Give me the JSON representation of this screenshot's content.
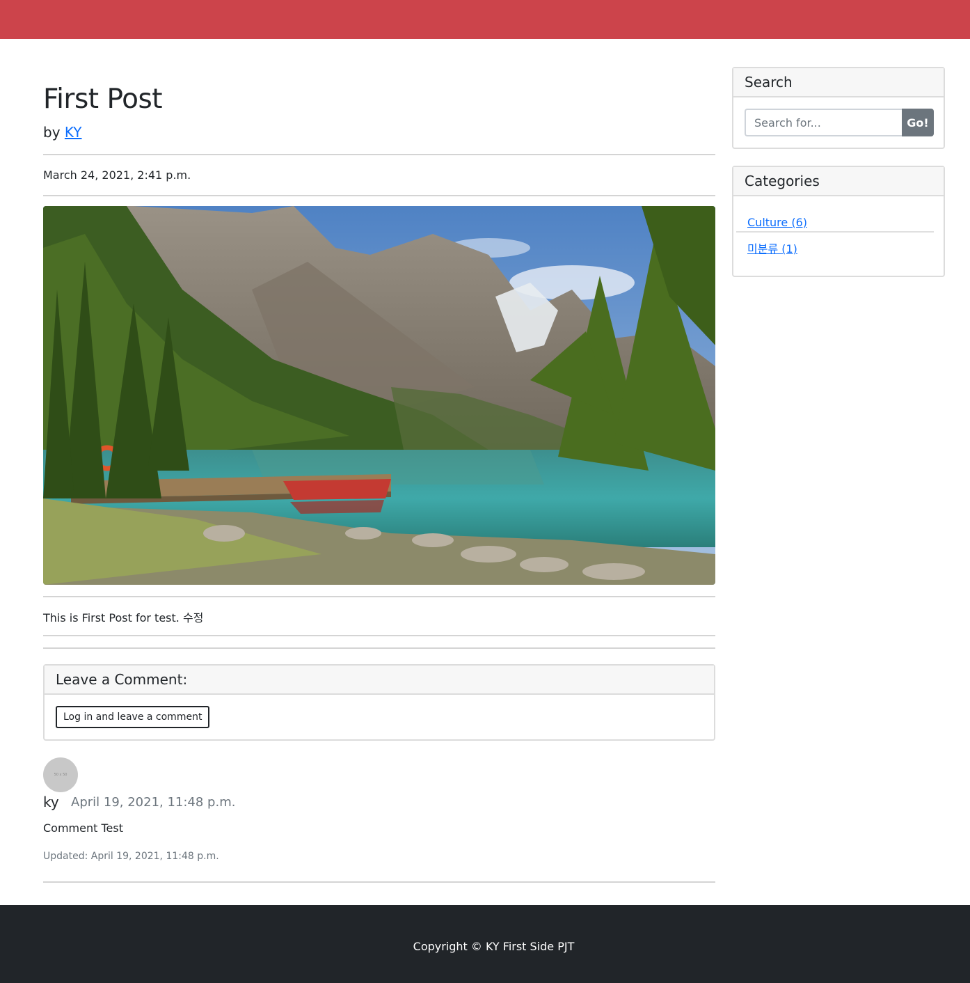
{
  "post": {
    "title": "First Post",
    "by_prefix": "by",
    "author": "KY",
    "date": "March 24, 2021, 2:41 p.m.",
    "body": "This is First Post for test. 수정"
  },
  "comment_form": {
    "header": "Leave a Comment:",
    "login_button": "Log in and leave a comment"
  },
  "comments": [
    {
      "avatar_label": "50 x 50",
      "author": "ky",
      "date": "April 19, 2021, 11:48 p.m.",
      "text": "Comment Test",
      "updated": "Updated: April 19, 2021, 11:48 p.m."
    }
  ],
  "sidebar": {
    "search": {
      "header": "Search",
      "placeholder": "Search for...",
      "button": "Go!"
    },
    "categories": {
      "header": "Categories",
      "items": [
        {
          "label": "Culture (6)"
        },
        {
          "label": "미분류 (1)"
        }
      ]
    }
  },
  "footer": {
    "copyright": "Copyright © KY First Side PJT"
  },
  "colors": {
    "topbar": "#cc444b",
    "footer": "#212529",
    "link": "#0d6efd",
    "button_secondary": "#6c757d"
  }
}
